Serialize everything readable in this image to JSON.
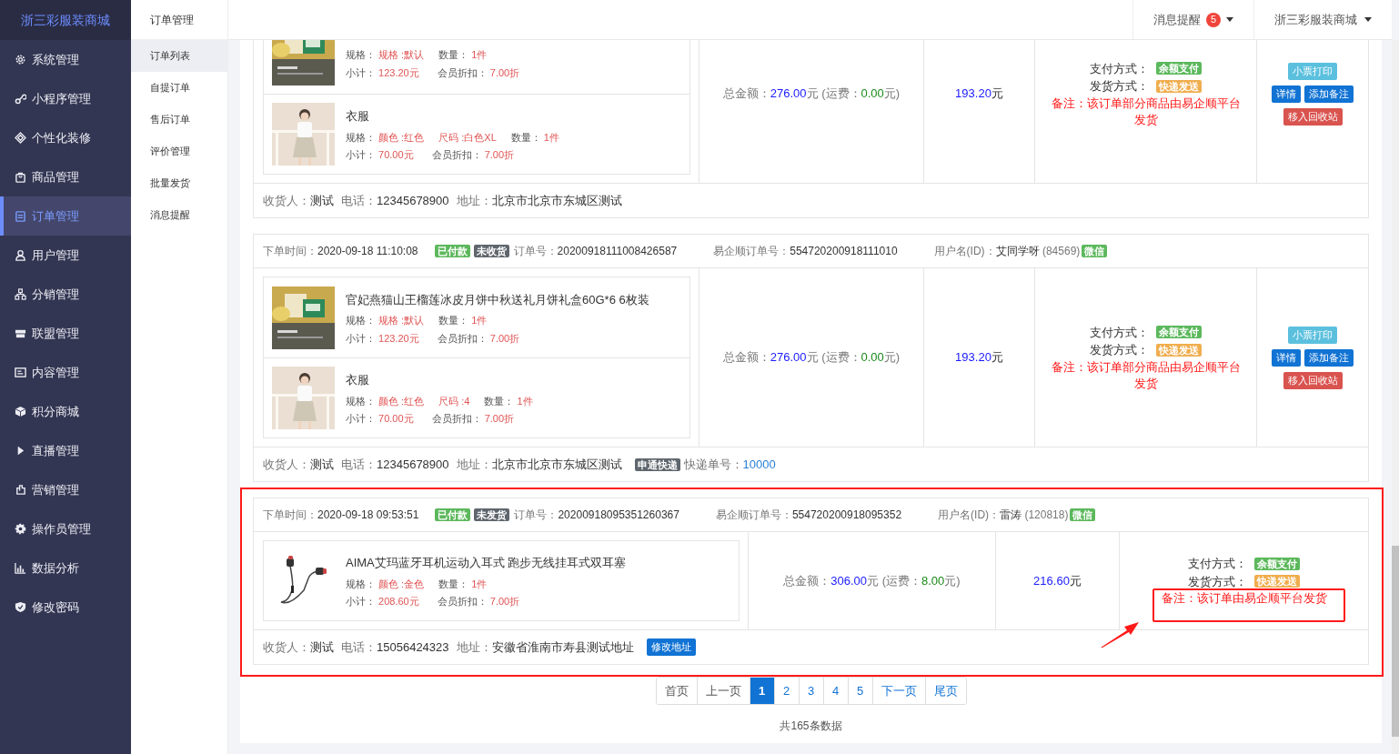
{
  "sidebar": {
    "logo": "浙三彩服装商城",
    "items": [
      {
        "label": "系统管理",
        "selected": false
      },
      {
        "label": "小程序管理",
        "selected": false
      },
      {
        "label": "个性化装修",
        "selected": false
      },
      {
        "label": "商品管理",
        "selected": false
      },
      {
        "label": "订单管理",
        "selected": true
      },
      {
        "label": "用户管理",
        "selected": false
      },
      {
        "label": "分销管理",
        "selected": false
      },
      {
        "label": "联盟管理",
        "selected": false
      },
      {
        "label": "内容管理",
        "selected": false
      },
      {
        "label": "积分商城",
        "selected": false
      },
      {
        "label": "直播管理",
        "selected": false
      },
      {
        "label": "营销管理",
        "selected": false
      },
      {
        "label": "操作员管理",
        "selected": false
      },
      {
        "label": "数据分析",
        "selected": false
      },
      {
        "label": "修改密码",
        "selected": false
      }
    ]
  },
  "submenu": {
    "title": "订单管理",
    "items": [
      {
        "label": "订单列表",
        "selected": true
      },
      {
        "label": "自提订单",
        "selected": false
      },
      {
        "label": "售后订单",
        "selected": false
      },
      {
        "label": "评价管理",
        "selected": false
      },
      {
        "label": "批量发货",
        "selected": false
      },
      {
        "label": "消息提醒",
        "selected": false
      }
    ]
  },
  "topbar": {
    "notifications": {
      "label": "消息提醒",
      "count": "5"
    },
    "account": "浙三彩服装商城"
  },
  "orders": [
    {
      "highlighted": false,
      "products": [
        {
          "specs": [
            {
              "label": "规格：",
              "value": "规格 :默认"
            },
            {
              "label": "数量：",
              "value": "1件"
            }
          ],
          "subtotal_label": "小计：",
          "subtotal": "123.20元",
          "discount_label": "会员折扣：",
          "discount": "7.00折"
        },
        {
          "title": "衣服",
          "specs": [
            {
              "label": "规格：",
              "value": "颜色 :红色"
            },
            {
              "value": "尺码 :白色XL"
            },
            {
              "label": "数量：",
              "value": "1件"
            }
          ],
          "subtotal_label": "小计：",
          "subtotal": "70.00元",
          "discount_label": "会员折扣：",
          "discount": "7.00折"
        }
      ],
      "total_label": "总金额：",
      "total": "276.00",
      "total_unit": "元",
      "freight_label": " (运费：",
      "freight": "0.00",
      "freight_unit": "元)",
      "paid": "193.20",
      "paid_unit": "元",
      "payment_label": "支付方式：",
      "payment": "余额支付",
      "shipping_label": "发货方式：",
      "shipping": "快递发送",
      "note": "备注：该订单部分商品由易企顺平台发货",
      "note_marked": false,
      "actions": [
        {
          "buttons": [
            {
              "text": "小票打印",
              "kind": "info"
            }
          ]
        },
        {
          "buttons": [
            {
              "text": "详情",
              "kind": "primary"
            },
            {
              "text": "添加备注",
              "kind": "primary"
            }
          ]
        },
        {
          "buttons": [
            {
              "text": "移入回收站",
              "kind": "danger"
            }
          ]
        }
      ],
      "footer": {
        "receiver_label": "收货人：",
        "receiver": "测试",
        "phone_label": "电话：",
        "phone": "12345678900",
        "address_label": "地址：",
        "address": "北京市北京市东城区测试"
      }
    },
    {
      "highlighted": false,
      "header": {
        "time_label": "下单时间：",
        "time": "2020-09-18 11:10:08",
        "tags": [
          {
            "text": "已付款",
            "color": "#5cb85c"
          },
          {
            "text": "未收货",
            "color": "#5f666d"
          }
        ],
        "order_no_label": "订单号：",
        "order_no": "20200918111008426587",
        "partner_no_label": "易企顺订单号：",
        "partner_no": "554720200918111010",
        "user_label": "用户名(ID)：",
        "user": "艾同学呀",
        "user_id": " (84569)",
        "channel": "微信"
      },
      "products": [
        {
          "title": "官妃燕猫山王榴莲冰皮月饼中秋送礼月饼礼盒60G*6 6枚装",
          "specs": [
            {
              "label": "规格：",
              "value": "规格 :默认"
            },
            {
              "label": "数量：",
              "value": "1件"
            }
          ],
          "subtotal_label": "小计：",
          "subtotal": "123.20元",
          "discount_label": "会员折扣：",
          "discount": "7.00折"
        },
        {
          "title": "衣服",
          "specs": [
            {
              "label": "规格：",
              "value": "颜色 :红色"
            },
            {
              "value": "尺码 :4"
            },
            {
              "label": "数量：",
              "value": "1件"
            }
          ],
          "subtotal_label": "小计：",
          "subtotal": "70.00元",
          "discount_label": "会员折扣：",
          "discount": "7.00折"
        }
      ],
      "total_label": "总金额：",
      "total": "276.00",
      "total_unit": "元",
      "freight_label": " (运费：",
      "freight": "0.00",
      "freight_unit": "元)",
      "paid": "193.20",
      "paid_unit": "元",
      "payment_label": "支付方式：",
      "payment": "余额支付",
      "shipping_label": "发货方式：",
      "shipping": "快递发送",
      "note": "备注：该订单部分商品由易企顺平台发货",
      "note_marked": false,
      "actions": [
        {
          "buttons": [
            {
              "text": "小票打印",
              "kind": "info"
            }
          ]
        },
        {
          "buttons": [
            {
              "text": "详情",
              "kind": "primary"
            },
            {
              "text": "添加备注",
              "kind": "primary"
            }
          ]
        },
        {
          "buttons": [
            {
              "text": "移入回收站",
              "kind": "danger"
            }
          ]
        }
      ],
      "footer": {
        "receiver_label": "收货人：",
        "receiver": "测试",
        "phone_label": "电话：",
        "phone": "12345678900",
        "address_label": "地址：",
        "address": "北京市北京市东城区测试",
        "courier": "申通快递",
        "tracking_label": "快递单号：",
        "tracking": "10000"
      }
    },
    {
      "highlighted": true,
      "header": {
        "time_label": "下单时间：",
        "time": "2020-09-18 09:53:51",
        "tags": [
          {
            "text": "已付款",
            "color": "#5cb85c"
          },
          {
            "text": "未发货",
            "color": "#5f666d"
          }
        ],
        "order_no_label": "订单号：",
        "order_no": "20200918095351260367",
        "partner_no_label": "易企顺订单号：",
        "partner_no": "554720200918095352",
        "user_label": "用户名(ID)：",
        "user": "雷涛",
        "user_id": " (120818)",
        "channel": "微信"
      },
      "products": [
        {
          "title": "AIMA艾玛蓝牙耳机运动入耳式 跑步无线挂耳式双耳塞",
          "specs": [
            {
              "label": "规格：",
              "value": "颜色 :金色"
            },
            {
              "label": "数量：",
              "value": "1件"
            }
          ],
          "subtotal_label": "小计：",
          "subtotal": "208.60元",
          "discount_label": "会员折扣：",
          "discount": "7.00折"
        }
      ],
      "total_label": "总金额：",
      "total": "306.00",
      "total_unit": "元",
      "freight_label": " (运费：",
      "freight": "8.00",
      "freight_unit": "元)",
      "paid": "216.60",
      "paid_unit": "元",
      "payment_label": "支付方式：",
      "payment": "余额支付",
      "shipping_label": "发货方式：",
      "shipping": "快递发送",
      "note": "备注：该订单由易企顺平台发货",
      "note_marked": true,
      "footer": {
        "receiver_label": "收货人：",
        "receiver": "测试",
        "phone_label": "电话：",
        "phone": "15056424323",
        "address_label": "地址：",
        "address": "安徽省淮南市寿县测试地址",
        "edit_address": "修改地址"
      }
    }
  ],
  "pagination": {
    "pages": [
      {
        "label": "首页",
        "selected": false
      },
      {
        "label": "上一页",
        "selected": false
      },
      {
        "label": "1",
        "selected": true
      },
      {
        "label": "2",
        "selected": false
      },
      {
        "label": "3",
        "selected": false
      },
      {
        "label": "4",
        "selected": false
      },
      {
        "label": "5",
        "selected": false
      },
      {
        "label": "下一页",
        "selected": false
      },
      {
        "label": "尾页",
        "selected": false
      }
    ],
    "summary": "共165条数据"
  }
}
